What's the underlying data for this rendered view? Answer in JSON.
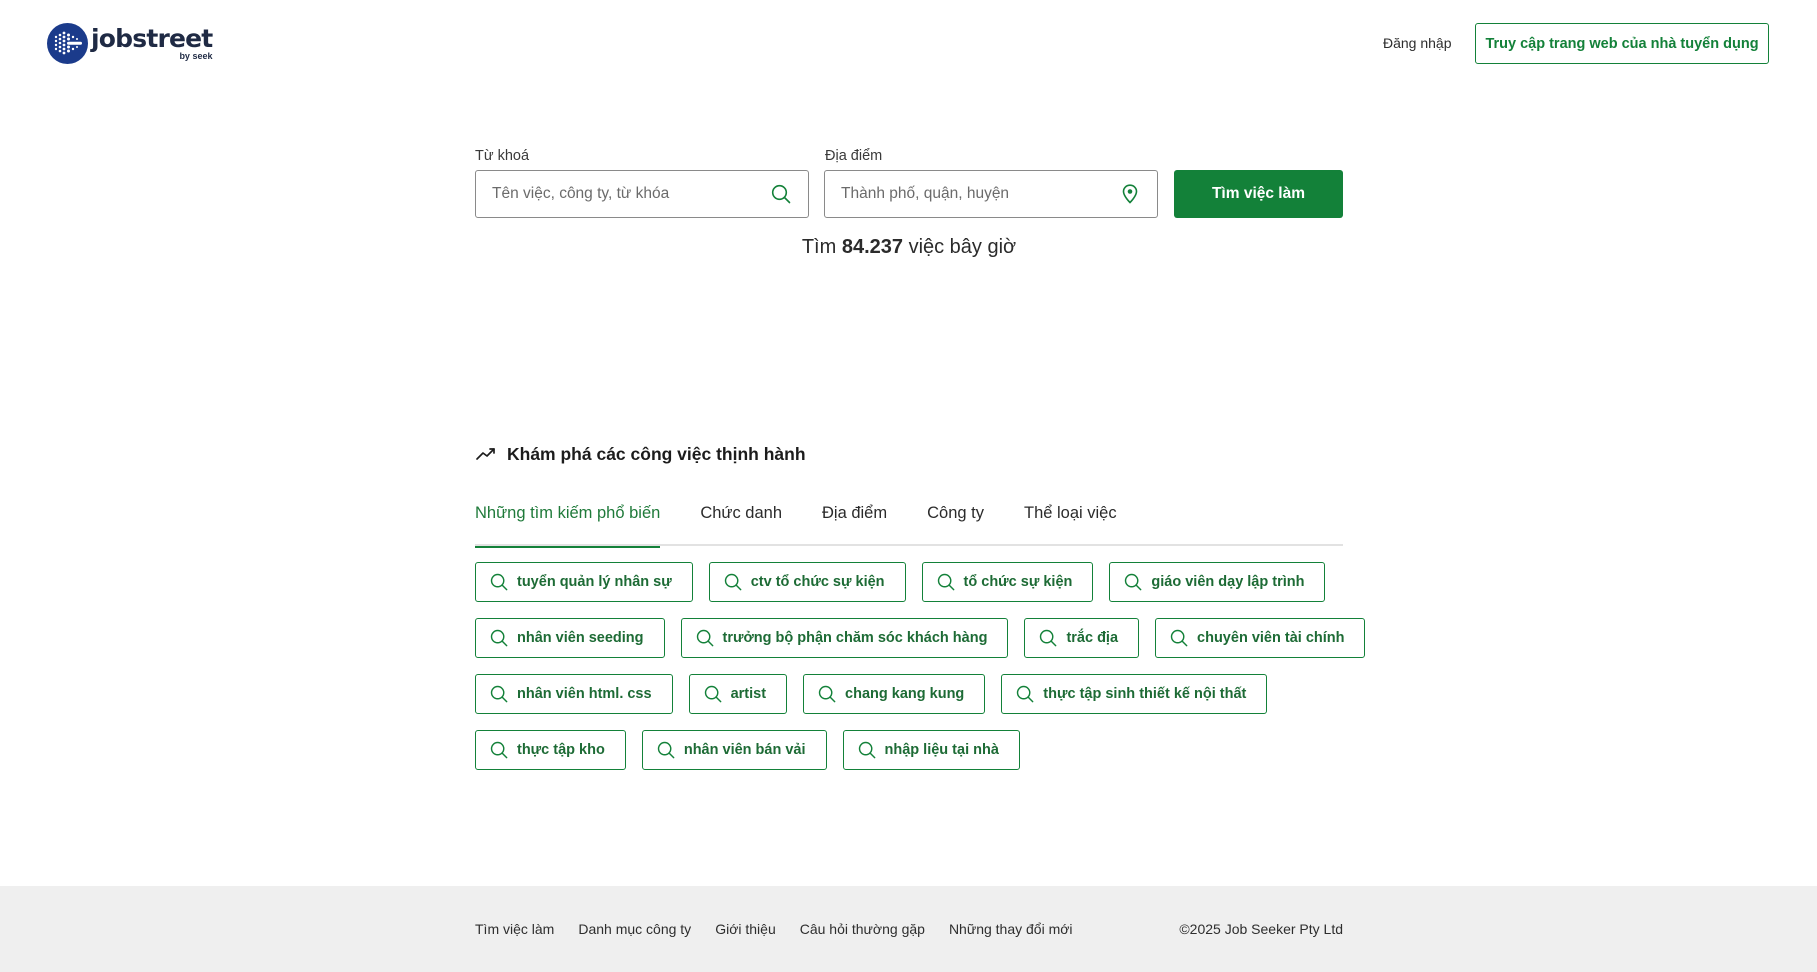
{
  "brand": {
    "name": "jobstreet",
    "sub": "by seek",
    "primary_color": "#138139",
    "logo_color": "#1b3b8b"
  },
  "header": {
    "login_label": "Đăng nhập",
    "employer_label": "Truy cập trang web của nhà tuyển dụng"
  },
  "search": {
    "keyword_label": "Từ khoá",
    "keyword_placeholder": "Tên việc, công ty, từ khóa",
    "location_label": "Địa điểm",
    "location_placeholder": "Thành phố, quận, huyện",
    "button_label": "Tìm việc làm",
    "count_prefix": "Tìm",
    "count_value": "84.237",
    "count_suffix": "việc bây giờ"
  },
  "trending": {
    "title": "Khám phá các công việc thịnh hành",
    "tabs": [
      {
        "label": "Những tìm kiếm phổ biến",
        "active": true
      },
      {
        "label": "Chức danh",
        "active": false
      },
      {
        "label": "Địa điểm",
        "active": false
      },
      {
        "label": "Công ty",
        "active": false
      },
      {
        "label": "Thể loại việc",
        "active": false
      }
    ],
    "chip_rows": [
      [
        "tuyển quản lý nhân sự",
        "ctv tổ chức sự kiện",
        "tổ chức sự kiện",
        "giáo viên dạy lập trình"
      ],
      [
        "nhân viên seeding",
        "trưởng bộ phận chăm sóc khách hàng",
        "trắc địa",
        "chuyên viên tài chính"
      ],
      [
        "nhân viên html. css",
        "artist",
        "chang kang kung",
        "thực tập sinh thiết kế nội thất"
      ],
      [
        "thực tập kho",
        "nhân viên bán vải",
        "nhập liệu tại nhà"
      ]
    ]
  },
  "footer": {
    "links": [
      "Tìm việc làm",
      "Danh mục công ty",
      "Giới thiệu",
      "Câu hỏi thường gặp",
      "Những thay đổi mới"
    ],
    "copyright": "©2025 Job Seeker Pty Ltd"
  }
}
